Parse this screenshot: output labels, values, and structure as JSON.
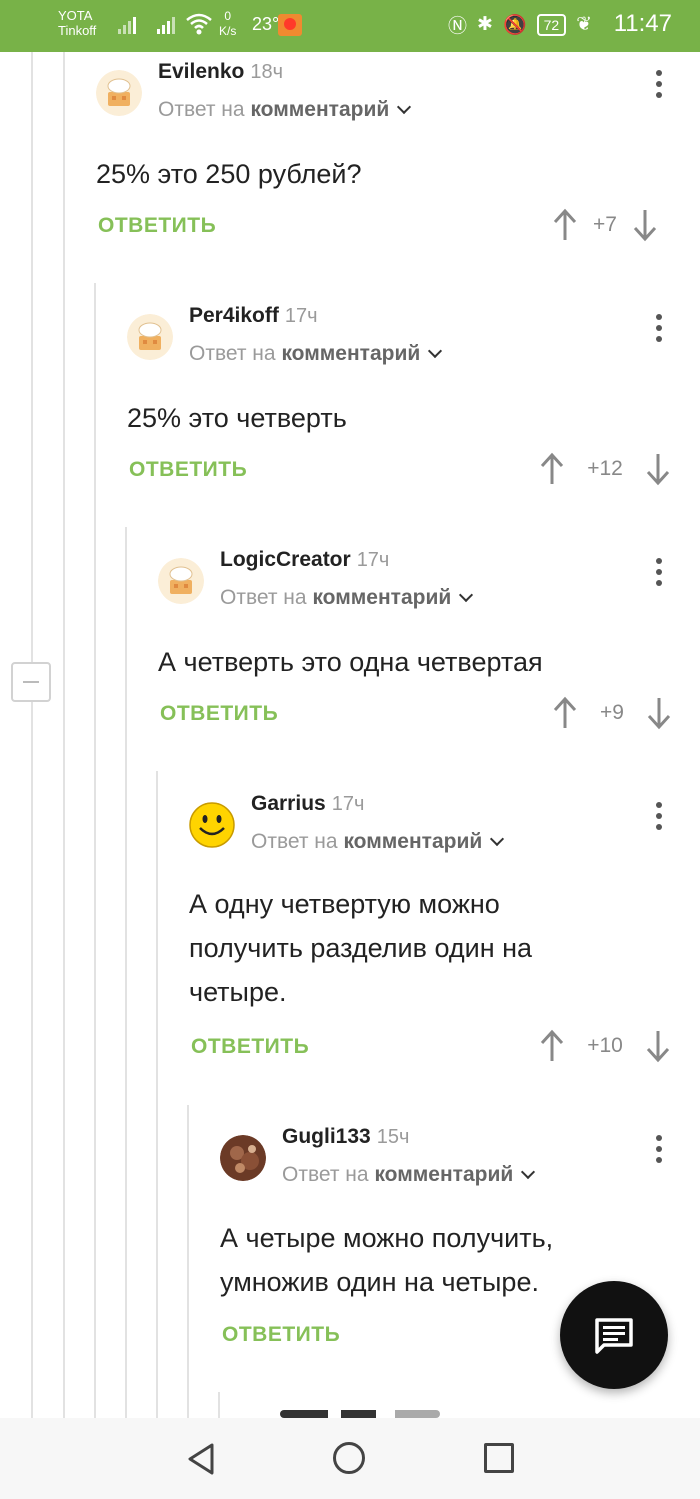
{
  "status_bar": {
    "carrier_1": "YOTA",
    "carrier_2": "Tinkoff",
    "speed_value": "0",
    "speed_unit": "K/s",
    "temperature": "23°",
    "battery": "72",
    "time": "11:47"
  },
  "comments": [
    {
      "author": "Evilenko",
      "time": "18ч",
      "reply_prefix": "Ответ на",
      "reply_target": "комментарий",
      "text": "25% это 250 рублей?",
      "reply_label": "ОТВЕТИТЬ",
      "score": "+7",
      "avatar": "cake-avatar"
    },
    {
      "author": "Per4ikoff",
      "time": "17ч",
      "reply_prefix": "Ответ на",
      "reply_target": "комментарий",
      "text": "25% это четверть",
      "reply_label": "ОТВЕТИТЬ",
      "score": "+12",
      "avatar": "cake-avatar"
    },
    {
      "author": "LogicCreator",
      "time": "17ч",
      "reply_prefix": "Ответ на",
      "reply_target": "комментарий",
      "text": "А четверть это одна четвертая",
      "reply_label": "ОТВЕТИТЬ",
      "score": "+9",
      "avatar": "cake-avatar"
    },
    {
      "author": "Garrius",
      "time": "17ч",
      "reply_prefix": "Ответ на",
      "reply_target": "комментарий",
      "text_lines": [
        "А одну четвертую можно",
        "получить разделив один на",
        "четыре."
      ],
      "reply_label": "ОТВЕТИТЬ",
      "score": "+10",
      "avatar": "smiley-avatar"
    },
    {
      "author": "Gugli133",
      "time": "15ч",
      "reply_prefix": "Ответ на",
      "reply_target": "комментарий",
      "text_lines": [
        "А четыре можно получить,",
        "умножив один на четыре."
      ],
      "reply_label": "ОТВЕТИТЬ",
      "avatar": "photo-avatar"
    }
  ],
  "colors": {
    "status_bar": "#78b248",
    "reply_green": "#86c058",
    "fab": "#111111"
  },
  "icons": [
    "arrow-up-icon",
    "arrow-down-icon",
    "more-vert-icon",
    "chevron-down-icon",
    "comment-fab-icon",
    "nav-back-icon",
    "nav-home-icon",
    "nav-recents-icon"
  ]
}
